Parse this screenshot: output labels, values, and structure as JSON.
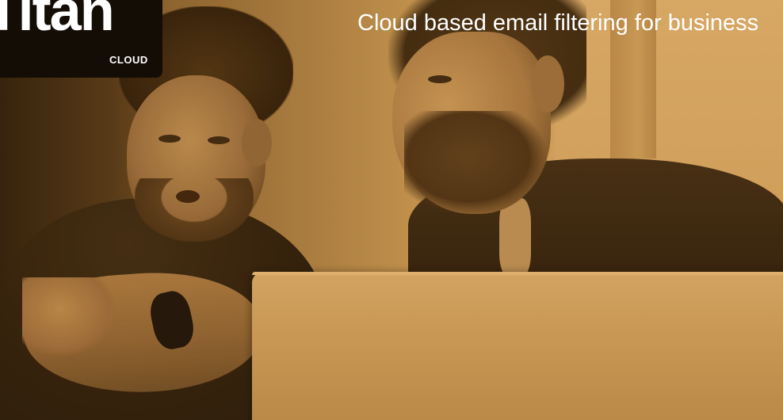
{
  "brand": {
    "title": "Titan",
    "subtitle": "CLOUD"
  },
  "tagline": "Cloud based email filtering for business",
  "colors": {
    "tint": "#c99a58",
    "text": "#ffffff",
    "logo_background": "#140d05"
  }
}
